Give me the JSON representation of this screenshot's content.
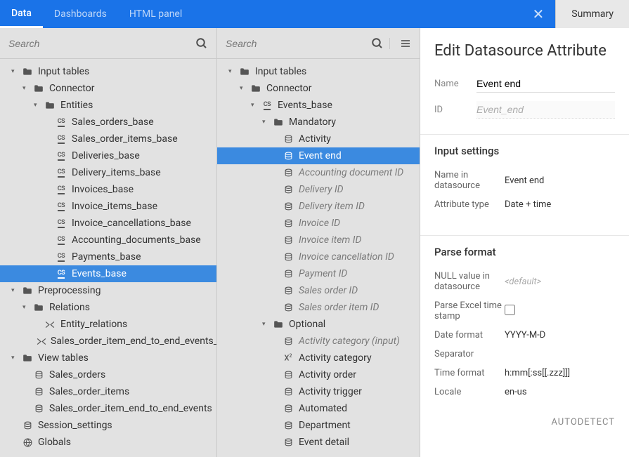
{
  "tabs": {
    "data": "Data",
    "dashboards": "Dashboards",
    "html_panel": "HTML panel",
    "summary": "Summary"
  },
  "search_placeholder": "Search",
  "left_tree": {
    "input_tables": "Input tables",
    "connector": "Connector",
    "entities": "Entities",
    "entities_children": [
      "Sales_orders_base",
      "Sales_order_items_base",
      "Deliveries_base",
      "Delivery_items_base",
      "Invoices_base",
      "Invoice_items_base",
      "Invoice_cancellations_base",
      "Accounting_documents_base",
      "Payments_base",
      "Events_base"
    ],
    "preprocessing": "Preprocessing",
    "relations": "Relations",
    "relations_children": [
      "Entity_relations",
      "Sales_order_item_end_to_end_events_base"
    ],
    "view_tables": "View tables",
    "view_children": [
      "Sales_orders",
      "Sales_order_items",
      "Sales_order_item_end_to_end_events"
    ],
    "session_settings": "Session_settings",
    "globals": "Globals"
  },
  "mid_tree": {
    "input_tables": "Input tables",
    "connector": "Connector",
    "events_base": "Events_base",
    "mandatory": "Mandatory",
    "mandatory_children": [
      {
        "label": "Activity",
        "muted": false,
        "sel": false
      },
      {
        "label": "Event end",
        "muted": false,
        "sel": true
      },
      {
        "label": "Accounting document ID",
        "muted": true,
        "sel": false
      },
      {
        "label": "Delivery ID",
        "muted": true,
        "sel": false
      },
      {
        "label": "Delivery item ID",
        "muted": true,
        "sel": false
      },
      {
        "label": "Invoice ID",
        "muted": true,
        "sel": false
      },
      {
        "label": "Invoice item ID",
        "muted": true,
        "sel": false
      },
      {
        "label": "Invoice cancellation ID",
        "muted": true,
        "sel": false
      },
      {
        "label": "Payment ID",
        "muted": true,
        "sel": false
      },
      {
        "label": "Sales order ID",
        "muted": true,
        "sel": false
      },
      {
        "label": "Sales order item ID",
        "muted": true,
        "sel": false
      }
    ],
    "optional": "Optional",
    "optional_children": [
      {
        "label": "Activity category (input)",
        "muted": true,
        "icon": "db"
      },
      {
        "label": "Activity category",
        "muted": false,
        "icon": "x2"
      },
      {
        "label": "Activity order",
        "muted": false,
        "icon": "db"
      },
      {
        "label": "Activity trigger",
        "muted": false,
        "icon": "db"
      },
      {
        "label": "Automated",
        "muted": false,
        "icon": "db"
      },
      {
        "label": "Department",
        "muted": false,
        "icon": "db"
      },
      {
        "label": "Event detail",
        "muted": false,
        "icon": "db"
      }
    ]
  },
  "edit_panel": {
    "title": "Edit Datasource Attribute",
    "name_label": "Name",
    "name_value": "Event end",
    "id_label": "ID",
    "id_value": "Event_end",
    "input_settings": {
      "heading": "Input settings",
      "name_in_ds_label": "Name in datasource",
      "name_in_ds_value": "Event end",
      "attr_type_label": "Attribute type",
      "attr_type_value": "Date + time"
    },
    "parse_format": {
      "heading": "Parse format",
      "null_label": "NULL value in datasource",
      "null_value": "<default>",
      "excel_label": "Parse Excel time stamp",
      "date_format_label": "Date format",
      "date_format_value": "YYYY-M-D",
      "separator_label": "Separator",
      "time_format_label": "Time format",
      "time_format_value": "h:mm[:ss[[.zzz]]]",
      "locale_label": "Locale",
      "locale_value": "en-us",
      "autodetect": "AUTODETECT"
    }
  }
}
